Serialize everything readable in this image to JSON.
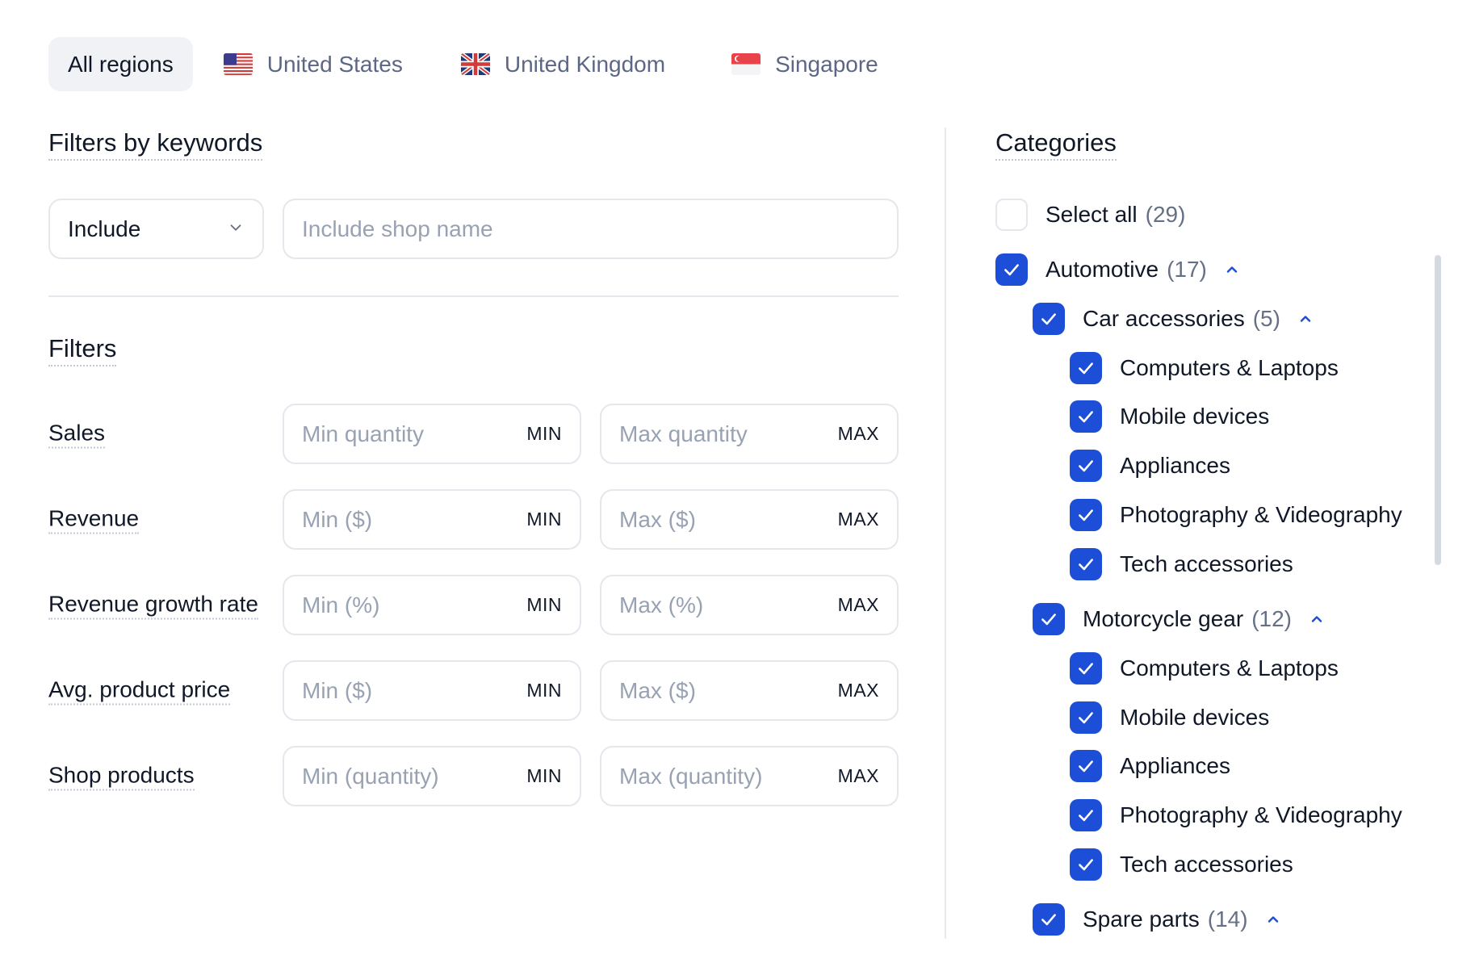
{
  "regions": {
    "tabs": [
      {
        "label": "All regions",
        "active": true,
        "flag": null
      },
      {
        "label": "United States",
        "active": false,
        "flag": "us-flag-icon"
      },
      {
        "label": "United Kingdom",
        "active": false,
        "flag": "uk-flag-icon"
      },
      {
        "label": "Singapore",
        "active": false,
        "flag": "sg-flag-icon"
      }
    ]
  },
  "keywords": {
    "title": "Filters by keywords",
    "mode_value": "Include",
    "shop_name_placeholder": "Include shop name"
  },
  "filters": {
    "title": "Filters",
    "rows": [
      {
        "label": "Sales",
        "min_placeholder": "Min quantity",
        "min_suffix": "MIN",
        "max_placeholder": "Max quantity",
        "max_suffix": "MAX"
      },
      {
        "label": "Revenue",
        "min_placeholder": "Min ($)",
        "min_suffix": "MIN",
        "max_placeholder": "Max ($)",
        "max_suffix": "MAX"
      },
      {
        "label": "Revenue growth rate",
        "min_placeholder": "Min (%)",
        "min_suffix": "MIN",
        "max_placeholder": "Max (%)",
        "max_suffix": "MAX"
      },
      {
        "label": "Avg. product price",
        "min_placeholder": "Min ($)",
        "min_suffix": "MIN",
        "max_placeholder": "Max ($)",
        "max_suffix": "MAX"
      },
      {
        "label": "Shop products",
        "min_placeholder": "Min (quantity)",
        "min_suffix": "MIN",
        "max_placeholder": "Max (quantity)",
        "max_suffix": "MAX"
      }
    ]
  },
  "categories": {
    "title": "Categories",
    "items": [
      {
        "label": "Select all",
        "count": "(29)",
        "checked": false,
        "level": 0,
        "caret": false
      },
      {
        "label": "Automotive",
        "count": "(17)",
        "checked": true,
        "level": 0,
        "caret": true
      },
      {
        "label": "Car accessories",
        "count": "(5)",
        "checked": true,
        "level": 1,
        "caret": true
      },
      {
        "label": "Computers & Laptops",
        "count": "",
        "checked": true,
        "level": 2,
        "caret": false
      },
      {
        "label": "Mobile devices",
        "count": "",
        "checked": true,
        "level": 2,
        "caret": false
      },
      {
        "label": "Appliances",
        "count": "",
        "checked": true,
        "level": 2,
        "caret": false
      },
      {
        "label": "Photography & Videography",
        "count": "",
        "checked": true,
        "level": 2,
        "caret": false
      },
      {
        "label": "Tech accessories",
        "count": "",
        "checked": true,
        "level": 2,
        "caret": false
      },
      {
        "label": "Motorcycle gear",
        "count": "(12)",
        "checked": true,
        "level": 1,
        "caret": true
      },
      {
        "label": "Computers & Laptops",
        "count": "",
        "checked": true,
        "level": 2,
        "caret": false
      },
      {
        "label": "Mobile devices",
        "count": "",
        "checked": true,
        "level": 2,
        "caret": false
      },
      {
        "label": "Appliances",
        "count": "",
        "checked": true,
        "level": 2,
        "caret": false
      },
      {
        "label": "Photography & Videography",
        "count": "",
        "checked": true,
        "level": 2,
        "caret": false
      },
      {
        "label": "Tech accessories",
        "count": "",
        "checked": true,
        "level": 2,
        "caret": false
      },
      {
        "label": "Spare parts",
        "count": "(14)",
        "checked": true,
        "level": 1,
        "caret": true
      }
    ]
  },
  "colors": {
    "accent": "#1d4ed8",
    "muted_text": "#5b6785",
    "placeholder": "#98a2b3",
    "border": "#e4e7ec"
  }
}
